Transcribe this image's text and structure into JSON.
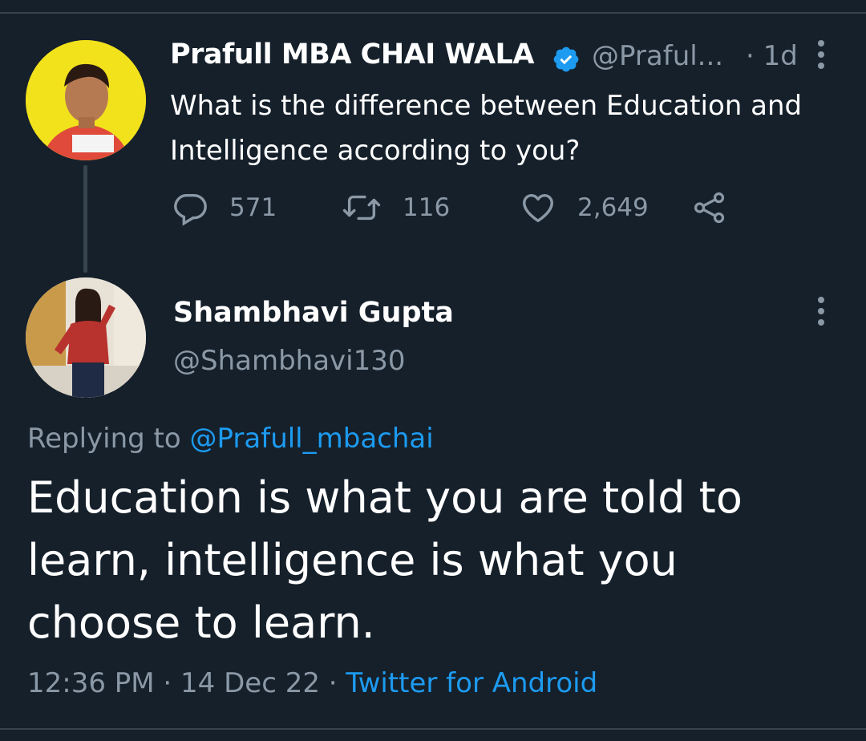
{
  "original_tweet": {
    "author_name": "Prafull MBA CHAI WALA",
    "author_handle": "@Praful...",
    "time": "· 1d",
    "text": "What is the difference between Education and Intelligence according to you?",
    "actions": {
      "replies": "571",
      "retweets": "116",
      "likes": "2,649"
    }
  },
  "reply_tweet": {
    "author_name": "Shambhavi Gupta",
    "author_handle": "@Shambhavi130",
    "replying_prefix": "Replying to",
    "replying_to": "@Prafull_mbachai",
    "text": "Education is what you are told to learn,  intelligence is what you choose to learn.",
    "timestamp": "12:36 PM · 14 Dec 22 ·",
    "client": "Twitter for Android"
  },
  "colors": {
    "background": "#15202b",
    "accent": "#1d9bf0",
    "secondary_text": "#8b98a5",
    "divider": "#38444d"
  }
}
